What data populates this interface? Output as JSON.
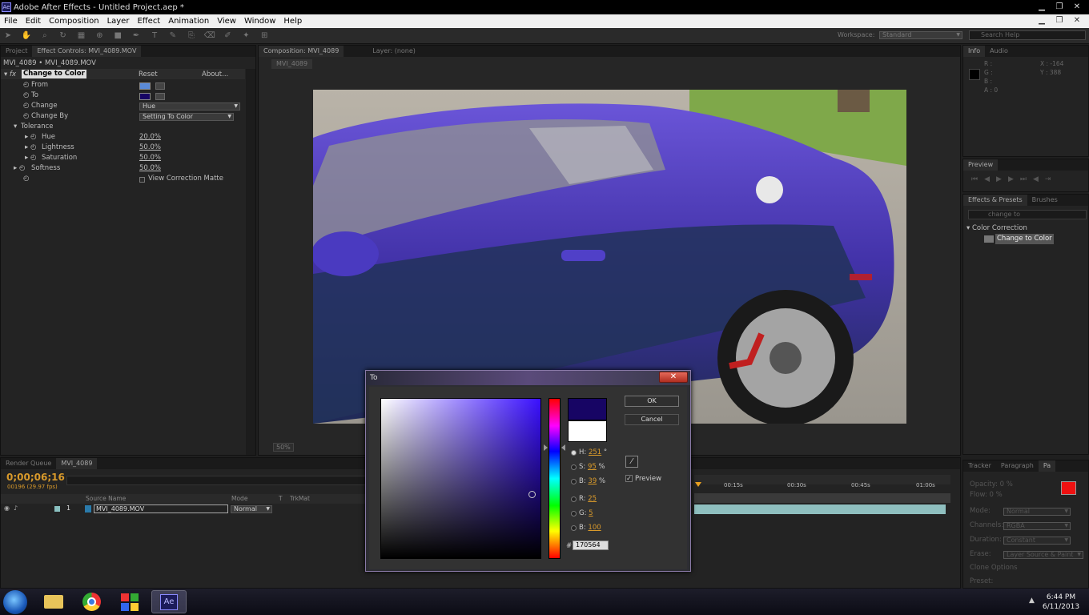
{
  "window": {
    "title": "Adobe After Effects - Untitled Project.aep *",
    "app_badge": "Ae"
  },
  "menu": [
    "File",
    "Edit",
    "Composition",
    "Layer",
    "Effect",
    "Animation",
    "View",
    "Window",
    "Help"
  ],
  "workspace": {
    "label": "Workspace:",
    "value": "Standard",
    "search_placeholder": "Search Help"
  },
  "effect_controls": {
    "tabs": [
      "Project",
      "Effect Controls: MVI_4089.MOV"
    ],
    "breadcrumb": "MVI_4089 • MVI_4089.MOV",
    "effect_name": "Change to Color",
    "reset": "Reset",
    "about": "About...",
    "props": {
      "from": "From",
      "to": "To",
      "change": "Change",
      "change_value": "Hue",
      "change_by": "Change By",
      "change_by_value": "Setting To Color",
      "tolerance": "Tolerance",
      "hue": "Hue",
      "hue_value": "20.0%",
      "lightness": "Lightness",
      "lightness_value": "50.0%",
      "saturation": "Saturation",
      "saturation_value": "50.0%",
      "softness": "Softness",
      "softness_value": "50.0%",
      "view_matte": "View Correction Matte"
    },
    "colors": {
      "from": "#5a8ad8",
      "to": "#170564"
    }
  },
  "composition": {
    "tabs": [
      "Composition: MVI_4089",
      "Layer: (none)"
    ],
    "subtab": "MVI_4089",
    "zoom": "50%"
  },
  "info_panel": {
    "tabs": [
      "Info",
      "Audio"
    ],
    "r": "R :",
    "g": "G :",
    "b": "B :",
    "a": "A : 0",
    "x": "X : -164",
    "y": "Y : 388"
  },
  "preview_panel": {
    "tab": "Preview"
  },
  "effects_presets": {
    "tabs": [
      "Effects & Presets",
      "Brushes"
    ],
    "search": "change to",
    "category": "Color Correction",
    "item": "Change to Color"
  },
  "paint_panel": {
    "tabs": [
      "Tracker",
      "Paragraph",
      "Pa"
    ],
    "opacity": "Opacity: 0 %",
    "flow": "Flow: 0 %",
    "mode": "Mode:",
    "mode_value": "Normal",
    "channels": "Channels:",
    "channels_value": "RGBA",
    "duration": "Duration:",
    "duration_value": "Constant",
    "erase": "Erase:",
    "erase_value": "Layer Source & Paint",
    "clone": "Clone Options",
    "preset": "Preset:"
  },
  "timeline": {
    "tabs": [
      "Render Queue",
      "MVI_4089"
    ],
    "timecode": "0;00;06;16",
    "fps": "00196 (29.97 fps)",
    "columns": {
      "source": "Source Name",
      "mode": "Mode",
      "t": "T",
      "trkmat": "TrkMat"
    },
    "layer": {
      "index": "1",
      "name": "MVI_4089.MOV",
      "mode": "Normal"
    },
    "ruler": [
      "00:15s",
      "00:30s",
      "00:45s",
      "01:00s"
    ]
  },
  "dialog": {
    "title": "To",
    "ok": "OK",
    "cancel": "Cancel",
    "preview": "Preview",
    "h_label": "H:",
    "h": "251",
    "h_unit": "°",
    "s_label": "S:",
    "s": "95",
    "s_unit": "%",
    "b_label": "B:",
    "b": "39",
    "b_unit": "%",
    "r_label": "R:",
    "r": "25",
    "g_label": "G:",
    "g": "5",
    "bb_label": "B:",
    "bb": "100",
    "hex_label": "#",
    "hex": "170564",
    "new_color": "#170564",
    "old_color": "#ffffff"
  },
  "taskbar": {
    "time": "6:44 PM",
    "date": "6/11/2013"
  }
}
